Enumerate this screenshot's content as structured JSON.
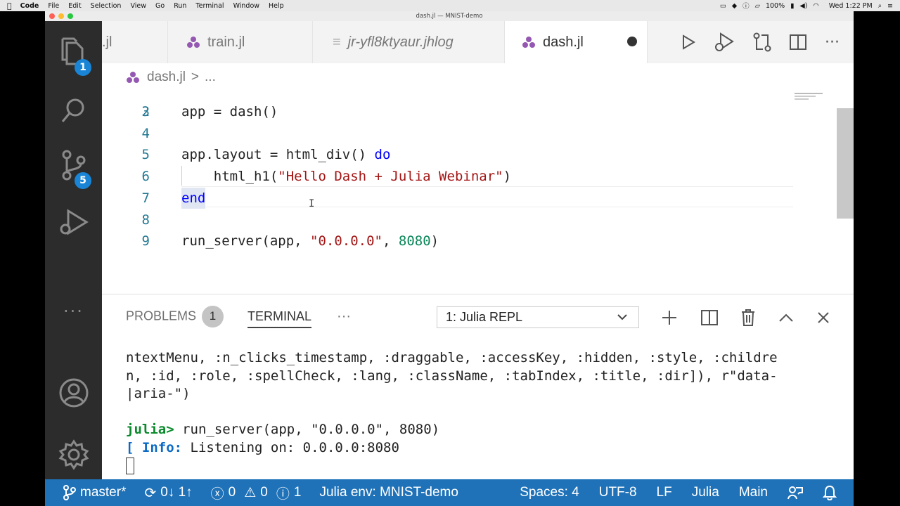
{
  "menubar": {
    "items": [
      "Code",
      "File",
      "Edit",
      "Selection",
      "View",
      "Go",
      "Run",
      "Terminal",
      "Window",
      "Help"
    ],
    "battery": "100%",
    "clock": "Wed 1:22 PM"
  },
  "window": {
    "title": "dash.jl — MNIST-demo"
  },
  "activity": {
    "explorer_badge": "1",
    "scm_badge": "5"
  },
  "tabs": [
    {
      "label": ".jl"
    },
    {
      "label": "train.jl"
    },
    {
      "label": "jr-yfl8ktyaur.jhlog"
    },
    {
      "label": "dash.jl",
      "modified": true
    }
  ],
  "breadcrumb": {
    "file": "dash.jl",
    "sep": ">",
    "rest": "..."
  },
  "editor": {
    "partial_line_number": "2",
    "lines": [
      {
        "n": "3",
        "parts": [
          [
            "plain",
            "app = dash()"
          ]
        ]
      },
      {
        "n": "4",
        "parts": []
      },
      {
        "n": "5",
        "parts": [
          [
            "plain",
            "app.layout = html_div() "
          ],
          [
            "kw",
            "do"
          ]
        ]
      },
      {
        "n": "6",
        "parts": [
          [
            "plain",
            "    html_h1("
          ],
          [
            "str",
            "\"Hello Dash + Julia Webinar\""
          ],
          [
            "plain",
            ")"
          ]
        ]
      },
      {
        "n": "7",
        "parts": [
          [
            "kw",
            "end"
          ]
        ]
      },
      {
        "n": "8",
        "parts": []
      },
      {
        "n": "9",
        "parts": [
          [
            "plain",
            "run_server(app, "
          ],
          [
            "str",
            "\"0.0.0.0\""
          ],
          [
            "plain",
            ", "
          ],
          [
            "num",
            "8080"
          ],
          [
            "plain",
            ")"
          ]
        ]
      }
    ]
  },
  "panel": {
    "problems_label": "PROBLEMS",
    "problems_count": "1",
    "terminal_label": "TERMINAL",
    "more": "···",
    "terminal_select": "1: Julia REPL",
    "output": [
      "ntextMenu, :n_clicks_timestamp, :draggable, :accessKey, :hidden, :style, :childre",
      "n, :id, :role, :spellCheck, :lang, :className, :tabIndex, :title, :dir]), r\"data-",
      "|aria-\")",
      ""
    ],
    "prompt": "julia>",
    "command": " run_server(app, \"0.0.0.0\", 8080)",
    "info_prefix": "[ Info:",
    "info_text": " Listening on: 0.0.0.0:8080"
  },
  "status": {
    "branch": "master*",
    "sync": "0↓ 1↑",
    "errors": "0",
    "warnings": "0",
    "infos": "1",
    "julia_env": "Julia env: MNIST-demo",
    "spaces": "Spaces: 4",
    "encoding": "UTF-8",
    "eol": "LF",
    "language": "Julia",
    "main": "Main"
  }
}
